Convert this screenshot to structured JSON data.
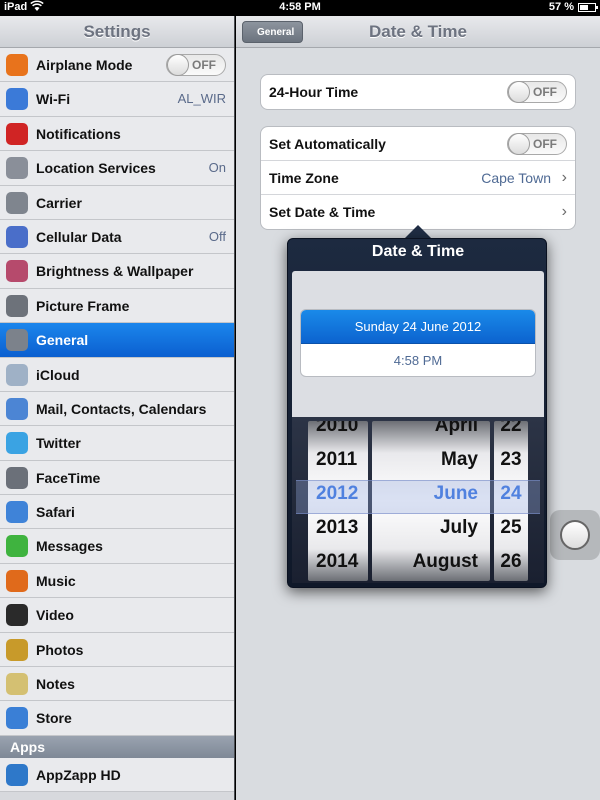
{
  "statusbar": {
    "device": "iPad",
    "time": "4:58 PM",
    "battery": "57 %",
    "battery_level": 0.57
  },
  "sidebar": {
    "title": "Settings",
    "items": [
      {
        "label": "Airplane Mode",
        "toggle": "OFF",
        "icon": "airplane-icon",
        "color": "#e8731c"
      },
      {
        "label": "Wi-Fi",
        "value": "AL_WIR",
        "icon": "wifi-icon",
        "color": "#3b7ad8"
      },
      {
        "label": "Notifications",
        "icon": "notifications-icon",
        "color": "#d02424"
      },
      {
        "label": "Location Services",
        "value": "On",
        "icon": "location-arrow-icon",
        "color": "#8a8f99"
      },
      {
        "label": "Carrier",
        "icon": "phone-icon",
        "color": "#7f858e"
      },
      {
        "label": "Cellular Data",
        "value": "Off",
        "icon": "antenna-icon",
        "color": "#4a6ec9"
      },
      {
        "label": "Brightness & Wallpaper",
        "icon": "flower-icon",
        "color": "#b64a6c"
      },
      {
        "label": "Picture Frame",
        "icon": "picture-frame-icon",
        "color": "#6d727a"
      },
      {
        "label": "General",
        "icon": "gear-icon",
        "color": "#7c828b",
        "selected": true
      },
      {
        "label": "iCloud",
        "icon": "cloud-icon",
        "color": "#9fb1c6"
      },
      {
        "label": "Mail, Contacts, Calendars",
        "icon": "mail-icon",
        "color": "#4c85d4"
      },
      {
        "label": "Twitter",
        "icon": "twitter-bird-icon",
        "color": "#3aa3e3"
      },
      {
        "label": "FaceTime",
        "icon": "facetime-camera-icon",
        "color": "#6b7079"
      },
      {
        "label": "Safari",
        "icon": "compass-icon",
        "color": "#3f83d8"
      },
      {
        "label": "Messages",
        "icon": "speech-bubble-icon",
        "color": "#3fb33f"
      },
      {
        "label": "Music",
        "icon": "music-note-icon",
        "color": "#e06a1b"
      },
      {
        "label": "Video",
        "icon": "clapperboard-icon",
        "color": "#2a2a2a"
      },
      {
        "label": "Photos",
        "icon": "sunflower-icon",
        "color": "#c89a2a"
      },
      {
        "label": "Notes",
        "icon": "notepad-icon",
        "color": "#d4c072"
      },
      {
        "label": "Store",
        "icon": "app-store-icon",
        "color": "#3a7fd6"
      }
    ],
    "section_apps": "Apps",
    "apps": [
      {
        "label": "AppZapp HD",
        "icon": "appzapp-icon",
        "color": "#2e78c9"
      }
    ]
  },
  "main": {
    "back_label": "General",
    "title": "Date & Time",
    "hour24": {
      "label": "24-Hour Time",
      "toggle": "OFF"
    },
    "set_auto": {
      "label": "Set Automatically",
      "toggle": "OFF"
    },
    "time_zone": {
      "label": "Time Zone",
      "value": "Cape Town"
    },
    "set_date": {
      "label": "Set Date & Time"
    }
  },
  "popover": {
    "title": "Date & Time",
    "date_row": "Sunday 24 June 2012",
    "time_row": "4:58 PM",
    "years": [
      "2010",
      "2011",
      "2012",
      "2013",
      "2014"
    ],
    "months": [
      "April",
      "May",
      "June",
      "July",
      "August"
    ],
    "days": [
      "22",
      "23",
      "24",
      "25",
      "26"
    ],
    "selected_index": 2
  }
}
